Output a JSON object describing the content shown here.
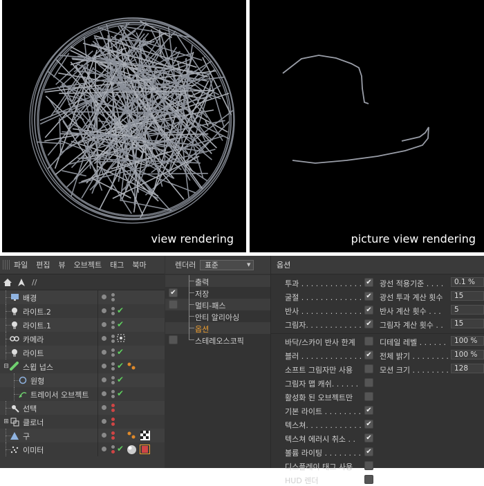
{
  "viewports": {
    "left_caption": "view rendering",
    "right_caption": "picture view rendering"
  },
  "object_manager": {
    "menu": [
      "파일",
      "편집",
      "뷰",
      "오브젝트",
      "태그",
      "북마"
    ],
    "path": "//",
    "objects": [
      {
        "name": "배경",
        "icon": "background-icon"
      },
      {
        "name": "라이트.2",
        "icon": "light-bulb-icon"
      },
      {
        "name": "라이트.1",
        "icon": "light-bulb-icon"
      },
      {
        "name": "카메라",
        "icon": "camera-icon"
      },
      {
        "name": "라이트",
        "icon": "light-bulb-icon"
      },
      {
        "name": "스윕 넙스",
        "icon": "sweep-nurbs-icon"
      },
      {
        "name": "원형",
        "icon": "circle-spline-icon"
      },
      {
        "name": "트레이서 오브젝트",
        "icon": "tracer-icon"
      },
      {
        "name": "선택",
        "icon": "selector-icon"
      },
      {
        "name": "클로너",
        "icon": "cloner-icon"
      },
      {
        "name": "구",
        "icon": "sphere-icon"
      },
      {
        "name": "이미터",
        "icon": "emitter-icon"
      }
    ]
  },
  "render_settings": {
    "renderer_label": "렌더러",
    "renderer_value": "표준",
    "items": [
      {
        "label": "출력",
        "checkbox": false,
        "checked": false
      },
      {
        "label": "저장",
        "checkbox": true,
        "checked": true
      },
      {
        "label": "멀티-패스",
        "checkbox": true,
        "checked": false
      },
      {
        "label": "안티 알리아싱",
        "checkbox": false,
        "checked": false
      },
      {
        "label": "옵션",
        "checkbox": false,
        "checked": false,
        "active": true
      },
      {
        "label": "스테레오스코픽",
        "checkbox": true,
        "checked": false
      }
    ]
  },
  "options": {
    "title": "옵션",
    "left": [
      {
        "label": "투과 . . . . . . . . . . . . . .",
        "checked": true
      },
      {
        "label": "굴절 . . . . . . . . . . . . . .",
        "checked": true
      },
      {
        "label": "반사 . . . . . . . . . . . . . .",
        "checked": true
      },
      {
        "label": "그림자. . . . . . . . . . . . .",
        "checked": true
      }
    ],
    "right": [
      {
        "label": "광선 적용기준 . . . .",
        "value": "0.1 %"
      },
      {
        "label": "광선 투과 계산 횟수",
        "value": "15"
      },
      {
        "label": "반사 계산 횟수 . . .",
        "value": "5"
      },
      {
        "label": "그림자 계산 횟수 . .",
        "value": "15"
      }
    ],
    "left2": [
      {
        "label": "바닥/스카이 반사 한계",
        "checked": false
      },
      {
        "label": "블러 . . . . . . . . . . . . . .",
        "checked": true
      },
      {
        "label": "소프트 그림자만 사용",
        "checked": false
      },
      {
        "label": "그림자 맵 캐쉬. . . . . .",
        "checked": false
      },
      {
        "label": "활성화 된 오브젝트만",
        "checked": false
      },
      {
        "label": "기본 라이트 . . . . . . . .",
        "checked": true
      },
      {
        "label": "텍스쳐. . . . . . . . . . . .",
        "checked": true
      },
      {
        "label": "텍스쳐 에러시 취소 . .",
        "checked": true
      },
      {
        "label": "볼륨 라이팅 . . . . . . . .",
        "checked": true
      },
      {
        "label": "디스플레이 태그 사용",
        "checked": false
      },
      {
        "label": "HUD 렌더",
        "checked": false
      }
    ],
    "right2": [
      {
        "label": "디테일 레벨 . . . . . .",
        "value": "100 %"
      },
      {
        "label": "전체 밝기 . . . . . . . .",
        "value": "100 %"
      },
      {
        "label": "모션 크기 . . . . . . . .",
        "value": "128"
      }
    ]
  }
}
